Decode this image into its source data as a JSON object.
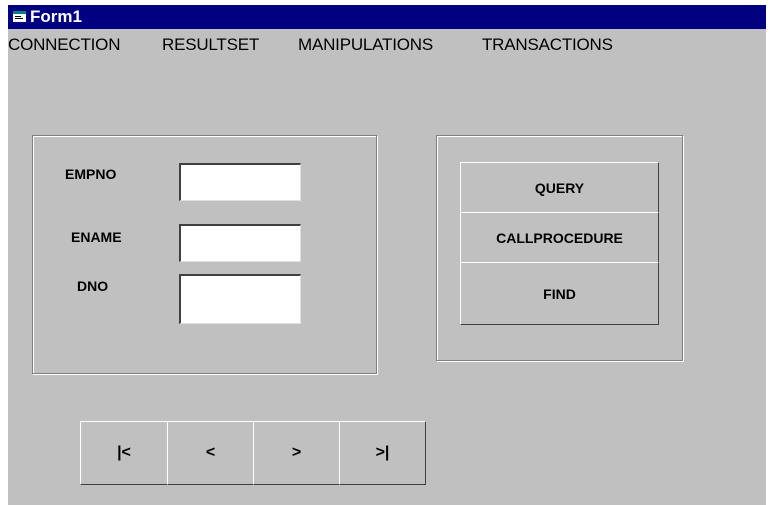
{
  "window": {
    "title": "Form1",
    "icon": "form-icon"
  },
  "menu": [
    "CONNECTION",
    "RESULTSET",
    "MANIPULATIONS",
    "TRANSACTIONS"
  ],
  "fields": [
    {
      "label": "EMPNO",
      "value": ""
    },
    {
      "label": "ENAME",
      "value": ""
    },
    {
      "label": "DNO",
      "value": ""
    }
  ],
  "actions": [
    "QUERY",
    "CALLPROCEDURE",
    "FIND"
  ],
  "navigation": {
    "first": "|<",
    "prev": "<",
    "next": ">",
    "last": ">|"
  },
  "colors": {
    "titlebar": "#000080",
    "face": "#c0c0c0",
    "input": "#ffffff"
  }
}
